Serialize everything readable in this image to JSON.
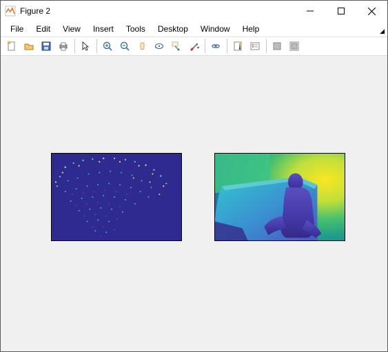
{
  "window": {
    "title": "Figure 2"
  },
  "menu": {
    "file": "File",
    "edit": "Edit",
    "view": "View",
    "insert": "Insert",
    "tools": "Tools",
    "desktop": "Desktop",
    "window": "Window",
    "help": "Help"
  },
  "toolbar": {
    "new": "new-figure-icon",
    "open": "open-icon",
    "save": "save-icon",
    "print": "print-icon",
    "pointer": "pointer-icon",
    "zoom_in": "zoom-in-icon",
    "zoom_out": "zoom-out-icon",
    "pan": "pan-icon",
    "rotate3d": "rotate-3d-icon",
    "datacursor": "data-cursor-icon",
    "brush": "brush-icon",
    "link": "link-icon",
    "colorbar": "colorbar-icon",
    "legend": "legend-icon",
    "hide_tools": "hide-plot-tools-icon",
    "show_tools": "show-plot-tools-icon"
  },
  "figure": {
    "bg_color": "#f0f0f0",
    "axes": [
      {
        "name": "axes-left",
        "colormap": "parula",
        "content": "sparse-dot-field"
      },
      {
        "name": "axes-right",
        "colormap": "parula",
        "content": "depth-map-person"
      }
    ]
  }
}
